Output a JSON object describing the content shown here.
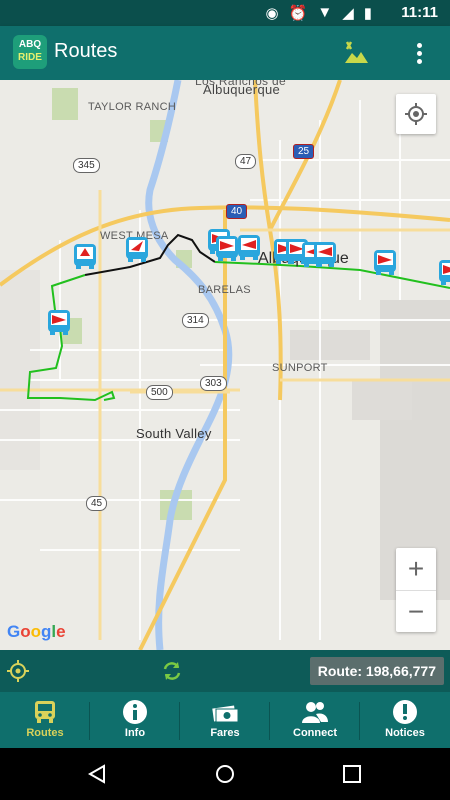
{
  "status_bar": {
    "time": "11:11"
  },
  "app_bar": {
    "logo_top": "ABQ",
    "logo_bottom": "RIDE",
    "title": "Routes"
  },
  "map": {
    "labels": {
      "taylor_ranch": "TAYLOR RANCH",
      "los_ranchos": "Los Ranchos de",
      "albuquerque_north": "Albuquerque",
      "west_mesa": "WEST MESA",
      "albuquerque": "Albuquerque",
      "barelas": "BARELAS",
      "sunport": "SUNPORT",
      "south_valley": "South Valley"
    },
    "shields": {
      "r345": "345",
      "r47": "47",
      "r25": "25",
      "r40": "40",
      "r314": "314",
      "r303": "303",
      "r500": "500",
      "r45": "45"
    },
    "attribution": "Google",
    "zoom_in": "+",
    "zoom_out": "−"
  },
  "route_bar": {
    "label": "Route: 198,66,777"
  },
  "bottom_nav": [
    {
      "label": "Routes",
      "icon": "bus-icon",
      "active": true
    },
    {
      "label": "Info",
      "icon": "info-icon",
      "active": false
    },
    {
      "label": "Fares",
      "icon": "money-icon",
      "active": false
    },
    {
      "label": "Connect",
      "icon": "people-icon",
      "active": false
    },
    {
      "label": "Notices",
      "icon": "alert-icon",
      "active": false
    }
  ],
  "colors": {
    "app_bar": "#0f6f6c",
    "route_green": "#22c01e",
    "active_tab": "#d9d25a",
    "bus_blue": "#2aa6dd",
    "bus_arrow": "#e02020"
  }
}
